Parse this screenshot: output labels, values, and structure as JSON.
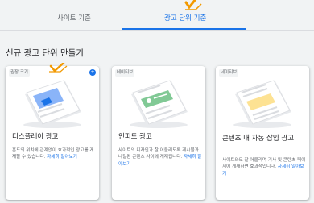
{
  "tabs": [
    {
      "label": "사이트 기준",
      "active": false
    },
    {
      "label": "광고 단위 기준",
      "active": true
    }
  ],
  "heading": "신규 광고 단위 만들기",
  "cards": [
    {
      "badge": "권장 크기",
      "title": "디스플레이 광고",
      "description": "홈드의 위치에 관계없이 효과적인 광고를 게재할 수 있습니다. ",
      "link": "자세히 알아보기",
      "icon": "display-ad-illustration"
    },
    {
      "badge": "네이티브",
      "title": "인피드 광고",
      "description": "사이트의 디자인과 잘 어울리도록 게시물과 나열된 콘텐츠 사이에 게재됩니다. ",
      "link": "자세히 알아보기",
      "icon": "infeed-ad-illustration"
    },
    {
      "badge": "네이티브",
      "title": "콘텐츠 내 자동 삽입 광고",
      "description": "사이트와도 잘 어울리며 기사 및 콘텐츠 페이지에 게재하면 효과적입니다. ",
      "link": "자세히 알아보기",
      "icon": "in-article-ad-illustration"
    }
  ],
  "colors": {
    "accent": "#1a73e8",
    "check": "#f29900",
    "background": "#f1f3f4"
  }
}
